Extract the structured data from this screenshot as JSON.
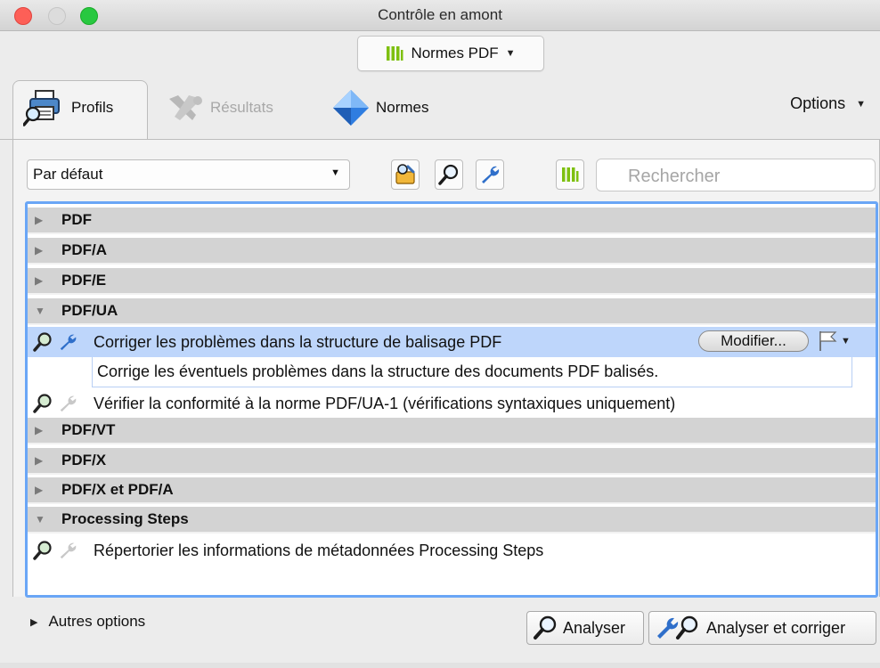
{
  "window": {
    "title": "Contrôle en amont"
  },
  "standards_selector": {
    "label": "Normes PDF"
  },
  "tabs": [
    {
      "label": "Profils",
      "active": true
    },
    {
      "label": "Résultats",
      "active": false
    },
    {
      "label": "Normes",
      "active": false
    }
  ],
  "options": {
    "label": "Options"
  },
  "profile_dropdown": {
    "value": "Par défaut"
  },
  "search": {
    "placeholder": "Rechercher"
  },
  "tree": {
    "groups": [
      {
        "label": "PDF",
        "expanded": false
      },
      {
        "label": "PDF/A",
        "expanded": false
      },
      {
        "label": "PDF/E",
        "expanded": false
      },
      {
        "label": "PDF/UA",
        "expanded": true
      },
      {
        "label": "PDF/VT",
        "expanded": false
      },
      {
        "label": "PDF/X",
        "expanded": false
      },
      {
        "label": "PDF/X et PDF/A",
        "expanded": false
      },
      {
        "label": "Processing Steps",
        "expanded": true
      }
    ],
    "items": {
      "pdfua_fix": {
        "label": "Corriger les problèmes dans la structure de balisage PDF",
        "description": "Corrige les éventuels problèmes dans la structure des documents PDF balisés.",
        "modify_label": "Modifier...",
        "selected": true
      },
      "pdfua_verify": {
        "label": "Vérifier la conformité à la norme PDF/UA-1 (vérifications syntaxiques uniquement)"
      },
      "processing_steps": {
        "label": "Répertorier les informations de métadonnées Processing Steps"
      }
    }
  },
  "bottom": {
    "more_options": "Autres options",
    "analyse": "Analyser",
    "analyse_fix": "Analyser et corriger"
  },
  "colors": {
    "selection": "#bed6fb",
    "focus_ring": "#6aa6f6",
    "group_row": "#d3d3d3",
    "standards_icon": "#7ec010"
  },
  "icons": {
    "standards": "bar-chart-icon",
    "profils": "printer-magnifier-icon",
    "resultats": "tools-cross-icon",
    "normes": "blue-diamond-icon",
    "analyse": "magnifier-icon",
    "fix": "wrench-icon",
    "flag": "flag-icon"
  }
}
